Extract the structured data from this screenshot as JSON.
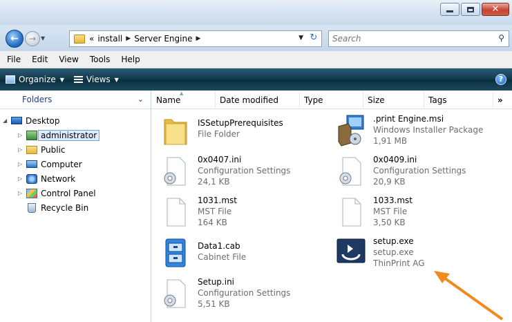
{
  "address": {
    "overflow": "«",
    "crumbs": [
      "install",
      "Server Engine"
    ]
  },
  "search": {
    "placeholder": "Search"
  },
  "menu": [
    "File",
    "Edit",
    "View",
    "Tools",
    "Help"
  ],
  "commands": {
    "organize": "Organize",
    "views": "Views",
    "help": "?"
  },
  "navpane": {
    "header": "Folders",
    "items": [
      {
        "label": "Desktop",
        "icon": "desktop-icon"
      },
      {
        "label": "administrator",
        "icon": "user-folder-icon"
      },
      {
        "label": "Public",
        "icon": "folder-icon"
      },
      {
        "label": "Computer",
        "icon": "computer-icon"
      },
      {
        "label": "Network",
        "icon": "network-icon"
      },
      {
        "label": "Control Panel",
        "icon": "control-panel-icon"
      },
      {
        "label": "Recycle Bin",
        "icon": "recycle-bin-icon"
      }
    ]
  },
  "columns": [
    "Name",
    "Date modified",
    "Type",
    "Size",
    "Tags",
    "»"
  ],
  "files": [
    {
      "name": "ISSetupPrerequisites",
      "line2": "File Folder",
      "line3": "",
      "icon": "folder-icon"
    },
    {
      "name": ".print Engine.msi",
      "line2": "Windows Installer Package",
      "line3": "1,91 MB",
      "icon": "installer-package-icon"
    },
    {
      "name": "0x0407.ini",
      "line2": "Configuration Settings",
      "line3": "24,1 KB",
      "icon": "config-settings-icon"
    },
    {
      "name": "0x0409.ini",
      "line2": "Configuration Settings",
      "line3": "20,9 KB",
      "icon": "config-settings-icon"
    },
    {
      "name": "1031.mst",
      "line2": "MST File",
      "line3": "164 KB",
      "icon": "blank-file-icon"
    },
    {
      "name": "1033.mst",
      "line2": "MST File",
      "line3": "3,50 KB",
      "icon": "blank-file-icon"
    },
    {
      "name": "Data1.cab",
      "line2": "Cabinet File",
      "line3": "",
      "icon": "cabinet-icon"
    },
    {
      "name": "setup.exe",
      "line2": "setup.exe",
      "line3": "ThinPrint AG",
      "icon": "setup-exe-icon"
    },
    {
      "name": "Setup.ini",
      "line2": "Configuration Settings",
      "line3": "5,51 KB",
      "icon": "config-settings-icon"
    }
  ],
  "colors": {
    "annotation_arrow": "#f08a1c",
    "command_bar": "#153c50",
    "link_blue": "#1e3f8a"
  }
}
